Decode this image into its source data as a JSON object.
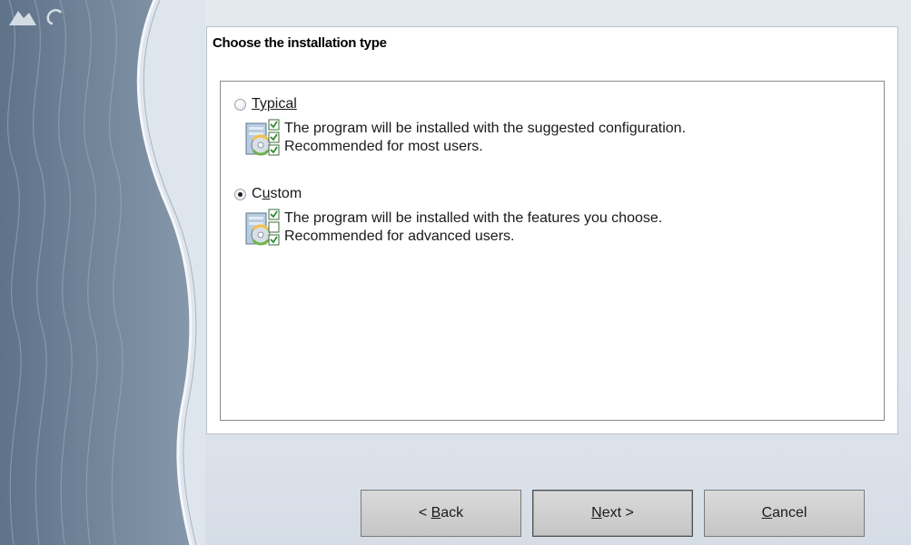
{
  "page": {
    "title": "Choose the installation type"
  },
  "options": [
    {
      "id": "typical",
      "label": "Typical",
      "selected": false,
      "description_lines": [
        "The program will be installed with the suggested configuration.",
        "Recommended for most users."
      ],
      "icon": "install-config-icon"
    },
    {
      "id": "custom",
      "label": "Custom",
      "selected": true,
      "description_lines": [
        "The program will be installed with the features you choose.",
        "Recommended for advanced users."
      ],
      "icon": "install-features-icon"
    }
  ],
  "buttons": {
    "back": {
      "prefix": "< ",
      "mnemonic": "B",
      "rest": "ack"
    },
    "next": {
      "mnemonic": "N",
      "rest": "ext >"
    },
    "cancel": {
      "mnemonic": "C",
      "rest": "ancel"
    }
  },
  "theme": {
    "sidebar_color": "#7a8da2",
    "panel_bg": "#ffffff",
    "button_bg": "#cfcfcf"
  }
}
